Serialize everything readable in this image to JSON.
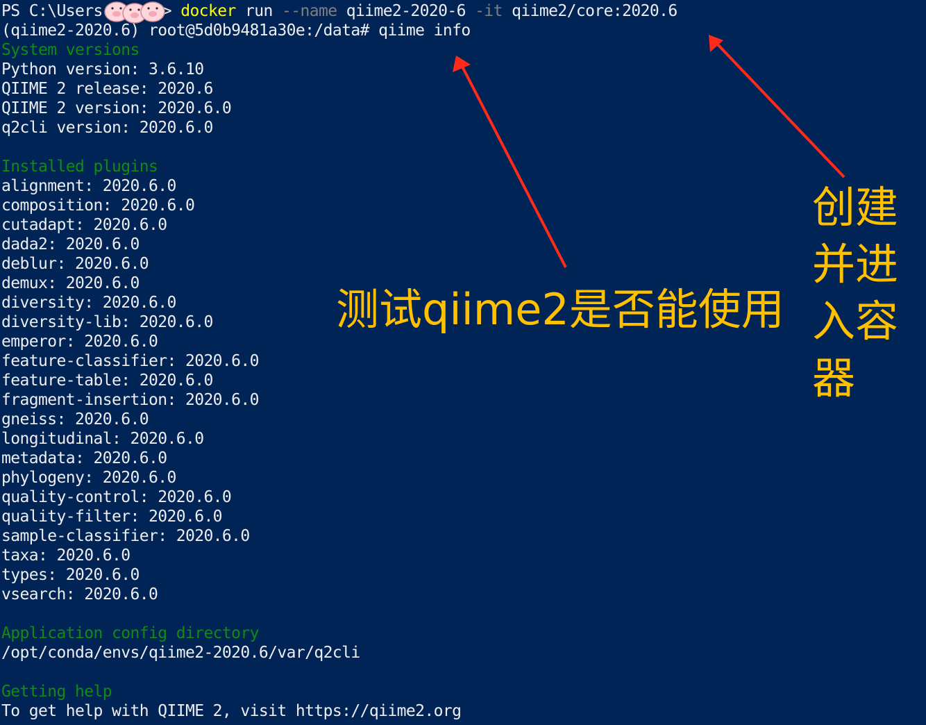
{
  "terminal": {
    "prompt_ps": "PS C:\\Users",
    "prompt_gt": "> ",
    "cmd_docker": "docker",
    "cmd_run": " run ",
    "cmd_name_flag": "--name",
    "cmd_name_val": " qiime2-2020-6 ",
    "cmd_it_flag": "-it",
    "cmd_image": " qiime2/core:2020.6",
    "prompt2": "(qiime2-2020.6) root@5d0b9481a30e:/data# qiime info",
    "sections": {
      "system": "System versions",
      "plugins": "Installed plugins",
      "config": "Application config directory",
      "help": "Getting help"
    },
    "system_lines": [
      "Python version: 3.6.10",
      "QIIME 2 release: 2020.6",
      "QIIME 2 version: 2020.6.0",
      "q2cli version: 2020.6.0"
    ],
    "plugins": [
      "alignment: 2020.6.0",
      "composition: 2020.6.0",
      "cutadapt: 2020.6.0",
      "dada2: 2020.6.0",
      "deblur: 2020.6.0",
      "demux: 2020.6.0",
      "diversity: 2020.6.0",
      "diversity-lib: 2020.6.0",
      "emperor: 2020.6.0",
      "feature-classifier: 2020.6.0",
      "feature-table: 2020.6.0",
      "fragment-insertion: 2020.6.0",
      "gneiss: 2020.6.0",
      "longitudinal: 2020.6.0",
      "metadata: 2020.6.0",
      "phylogeny: 2020.6.0",
      "quality-control: 2020.6.0",
      "quality-filter: 2020.6.0",
      "sample-classifier: 2020.6.0",
      "taxa: 2020.6.0",
      "types: 2020.6.0",
      "vsearch: 2020.6.0"
    ],
    "config_path": "/opt/conda/envs/qiime2-2020.6/var/q2cli",
    "help_line": "To get help with QIIME 2, visit https://qiime2.org"
  },
  "annotations": {
    "test_label": "测试qiime2是否能使用",
    "create_lines": [
      "创建",
      "并进",
      "入容",
      "器"
    ]
  },
  "colors": {
    "background": "#012456",
    "text": "#eeedf0",
    "section": "#138a13",
    "command": "#ffff00",
    "flag": "#7f7f7f",
    "annotation": "#ffc000",
    "arrow": "#ff2a1a"
  }
}
